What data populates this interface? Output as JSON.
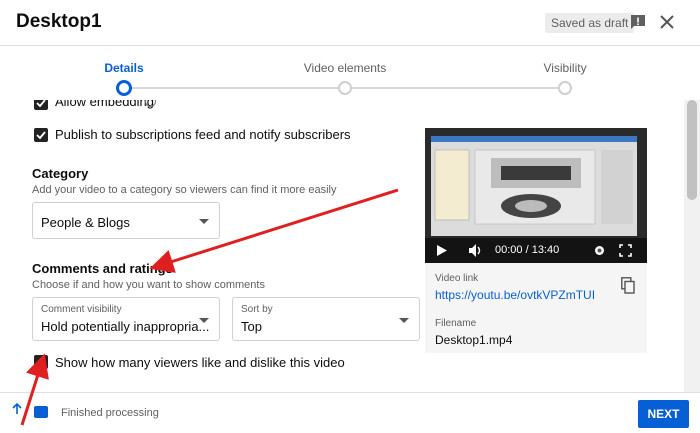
{
  "header": {
    "title": "Desktop1",
    "draft_badge": "Saved as draft"
  },
  "stepper": {
    "steps": [
      {
        "label": "Details",
        "active": true
      },
      {
        "label": "Video elements",
        "active": false
      },
      {
        "label": "Visibility",
        "active": false
      }
    ]
  },
  "options": {
    "embedding_label": "Allow embedding",
    "publish_label": "Publish to subscriptions feed and notify subscribers"
  },
  "category": {
    "title": "Category",
    "subtitle": "Add your video to a category so viewers can find it more easily",
    "selected": "People & Blogs"
  },
  "comments": {
    "title": "Comments and ratings",
    "subtitle": "Choose if and how you want to show comments",
    "visibility_caption": "Comment visibility",
    "visibility_value": "Hold potentially inappropria...",
    "sort_caption": "Sort by",
    "sort_value": "Top",
    "ratings_label": "Show how many viewers like and dislike this video"
  },
  "preview": {
    "time": "00:00 / 13:40",
    "link_label": "Video link",
    "link": "https://youtu.be/ovtkVPZmTUI",
    "filename_label": "Filename",
    "filename": "Desktop1.mp4"
  },
  "footer": {
    "status": "Finished processing",
    "next_label": "NEXT"
  },
  "colors": {
    "accent": "#065fd4",
    "annotation_arrow": "#e02020"
  }
}
